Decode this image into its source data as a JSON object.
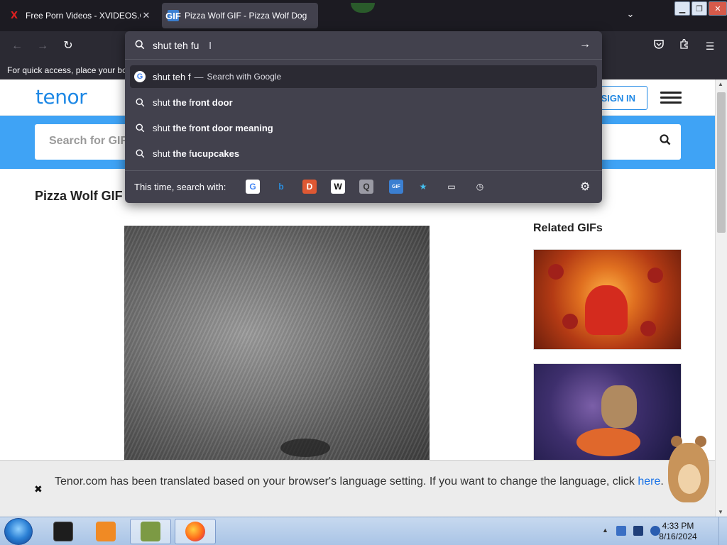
{
  "tabs": [
    {
      "title": "Free Porn Videos - XVIDEOS.COM",
      "favicon": "X",
      "close": "✕"
    },
    {
      "title": "Pizza Wolf GIF - Pizza Wolf Dog",
      "favicon": "GIF",
      "close": ""
    }
  ],
  "tabstrip": {
    "list_icon": "⌄"
  },
  "nav": {
    "back": "←",
    "forward": "→",
    "reload": "↻"
  },
  "bookmarks_text": "For quick access, place your bookmarks here on the bookmarks toolbar.",
  "urlbar": {
    "typed": "shut teh fu",
    "suggestions": [
      {
        "pre": "shut teh f",
        "bold": "",
        "sep": "—",
        "action": "Search with Google",
        "icon": "google-icon"
      },
      {
        "pre": "shut ",
        "bold": "the",
        "mid": " f",
        "bold2": "ront door",
        "icon": "search-icon"
      },
      {
        "pre": "shut ",
        "bold": "the",
        "mid": " f",
        "bold2": "ront door meaning",
        "icon": "search-icon"
      },
      {
        "pre": "shut ",
        "bold": "the",
        "mid": " f",
        "bold2": "ucupcakes",
        "icon": "search-icon"
      }
    ],
    "engines_label": "This time, search with:",
    "engines": [
      {
        "name": "google",
        "glyph": "G",
        "color": "#4285f4",
        "bg": "#ffffff"
      },
      {
        "name": "bing",
        "glyph": "b",
        "color": "#2a8fe0",
        "bg": "transparent"
      },
      {
        "name": "duckduckgo",
        "glyph": "D",
        "color": "#ffffff",
        "bg": "#de5833"
      },
      {
        "name": "wikipedia",
        "glyph": "W",
        "color": "#111111",
        "bg": "#ffffff"
      },
      {
        "name": "engine-5",
        "glyph": "Q",
        "color": "#333333",
        "bg": "#9a9aa4"
      },
      {
        "name": "tenor-gif",
        "glyph": "GIF",
        "color": "#ffffff",
        "bg": "#3b7fd1"
      },
      {
        "name": "bookmarks",
        "glyph": "★",
        "color": "#45c0f0",
        "bg": "transparent"
      },
      {
        "name": "tabs",
        "glyph": "▭",
        "color": "#fbfbfe",
        "bg": "transparent"
      },
      {
        "name": "history",
        "glyph": "◷",
        "color": "#fbfbfe",
        "bg": "transparent"
      }
    ]
  },
  "page": {
    "logo": "tenor",
    "signin": "SIGN IN",
    "search_placeholder": "Search for GIFs and Stickers",
    "title": "Pizza Wolf GIF",
    "related_title": "Related GIFs"
  },
  "notice": {
    "close": "✖",
    "message": "Tenor.com has been translated based on your browser's language setting. If you want to change the language, click",
    "link": "here",
    "suffix": "."
  },
  "taskbar": {
    "time": "4:33 PM",
    "date": "8/16/2024",
    "items": [
      {
        "name": "terminal",
        "active": false,
        "color": "#222"
      },
      {
        "name": "media-player",
        "active": false,
        "color": "#f08a24"
      },
      {
        "name": "box-app",
        "active": true,
        "color": "#6b8f3a"
      },
      {
        "name": "firefox",
        "active": true,
        "color": "#ff6a1a"
      }
    ]
  }
}
